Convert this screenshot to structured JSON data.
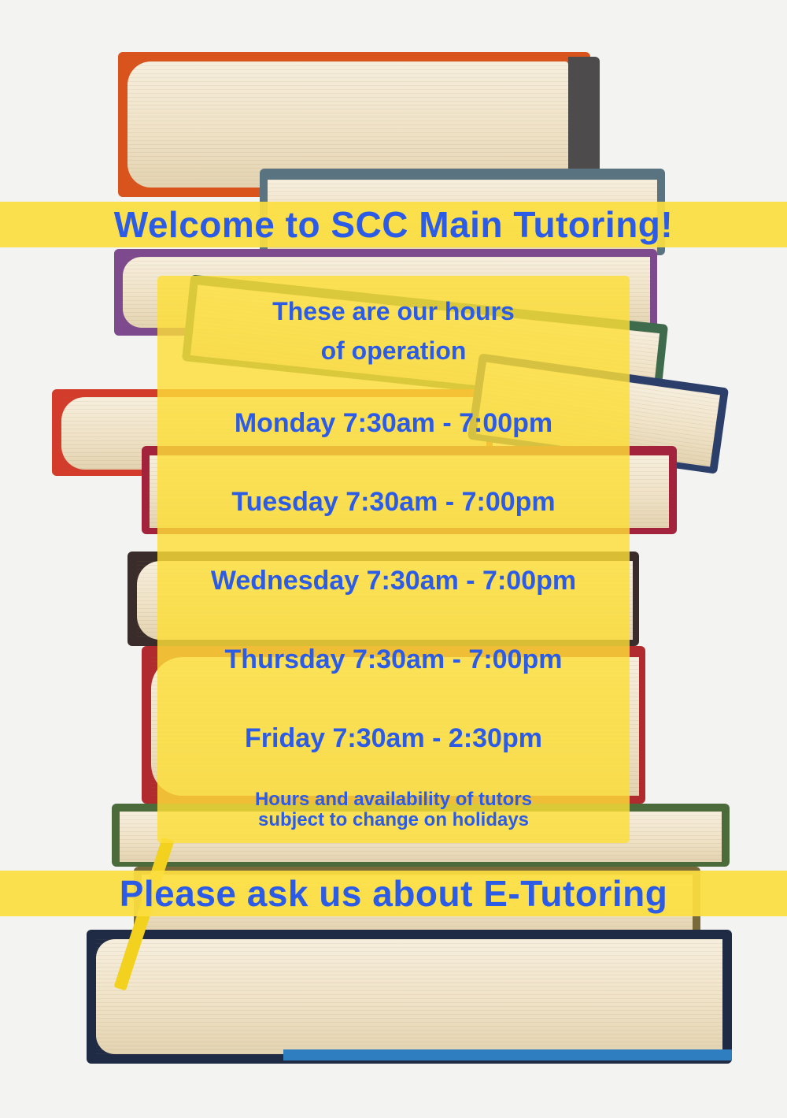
{
  "header": {
    "title": "Welcome to SCC Main Tutoring!"
  },
  "hours": {
    "intro_line1": "These are our hours",
    "intro_line2": "of operation",
    "days": [
      {
        "label": "Monday 7:30am - 7:00pm"
      },
      {
        "label": "Tuesday 7:30am - 7:00pm"
      },
      {
        "label": "Wednesday 7:30am - 7:00pm"
      },
      {
        "label": "Thursday 7:30am - 7:00pm"
      },
      {
        "label": "Friday 7:30am - 2:30pm"
      }
    ],
    "note_line1": "Hours and availability of tutors",
    "note_line2": "subject to change on holidays"
  },
  "footer": {
    "text": "Please ask us about E-Tutoring"
  },
  "colors": {
    "band_yellow": "#fcde40",
    "text_blue": "#2c5ce6"
  }
}
